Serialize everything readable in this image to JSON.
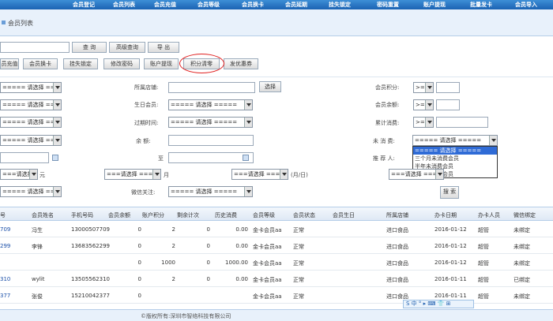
{
  "topnav": [
    "会员登记",
    "会员列表",
    "会员充值",
    "会员等级",
    "会员换卡",
    "会员延期",
    "挂失锁定",
    "密码重置",
    "账户提现",
    "批量发卡",
    "会员导入"
  ],
  "page_title": "会员列表",
  "toolbar": {
    "query": "查 询",
    "advanced": "高级查询",
    "export": "导 出"
  },
  "actions": [
    "员充值",
    "会员换卡",
    "挂失锁定",
    "修改密码",
    "账户提现",
    "积分清零",
    "发优惠券"
  ],
  "filters": {
    "select_default": "===== 请选择 =====",
    "select_short": "===请选择 ===",
    "store_label": "所属店铺:",
    "select_button": "选择",
    "birthday_label": "生日会员:",
    "expire_label": "过期时间:",
    "balance_label": "余   额:",
    "to_label": "至",
    "wechat_label": "微信关注:",
    "points_label": "会员积分:",
    "deposit_label": "会员余额:",
    "total_label": "累计消费:",
    "unconsumed_label": "未 消 费:",
    "referrer_label": "推 荐 人:",
    "op_default": ">=",
    "unit_yuan": "元",
    "unit_month": "月",
    "unit_mm": "(月/日)",
    "search_button": "搜 索"
  },
  "dropdown_options": [
    "===== 请选择 =====",
    "三个月未消费会员",
    "半年未消费会员",
    "一年未消费会员"
  ],
  "table": {
    "headers": [
      "号",
      "会员姓名",
      "手机号码",
      "会员余额",
      "账户积分",
      "剩余计次",
      "历史消费",
      "会员等级",
      "会员状态",
      "会员生日",
      "所属店铺",
      "办卡日期",
      "办卡人员",
      "微信绑定"
    ],
    "rows": [
      [
        "709",
        "冯生",
        "13000507709",
        "0",
        "2",
        "0",
        "0.00",
        "金卡会员aa",
        "正常",
        "",
        "进口食品",
        "2016-01-12",
        "超管",
        "未绑定"
      ],
      [
        "299",
        "李锋",
        "13683562299",
        "0",
        "2",
        "0",
        "0.00",
        "金卡会员aa",
        "正常",
        "",
        "进口食品",
        "2016-01-12",
        "超管",
        "未绑定"
      ],
      [
        "",
        "",
        "",
        "0",
        "1000",
        "0",
        "1000.00",
        "金卡会员aa",
        "正常",
        "",
        "进口食品",
        "2016-01-12",
        "超管",
        "未绑定"
      ],
      [
        "310",
        "wylit",
        "13505562310",
        "0",
        "2",
        "0",
        "0.00",
        "金卡会员aa",
        "正常",
        "",
        "进口食品",
        "2016-01-11",
        "超管",
        "已绑定"
      ],
      [
        "377",
        "张俊",
        "15210042377",
        "0",
        "",
        "",
        "",
        "金卡会员aa",
        "正常",
        "",
        "进口食品",
        "2016-01-11",
        "超管",
        "未绑定"
      ]
    ]
  },
  "footer": "©版权所有:深圳市智络科技有限公司",
  "colors": {
    "nav": "#1b62b2",
    "link": "#1a4fa8",
    "highlight_circle": "#e02020"
  }
}
